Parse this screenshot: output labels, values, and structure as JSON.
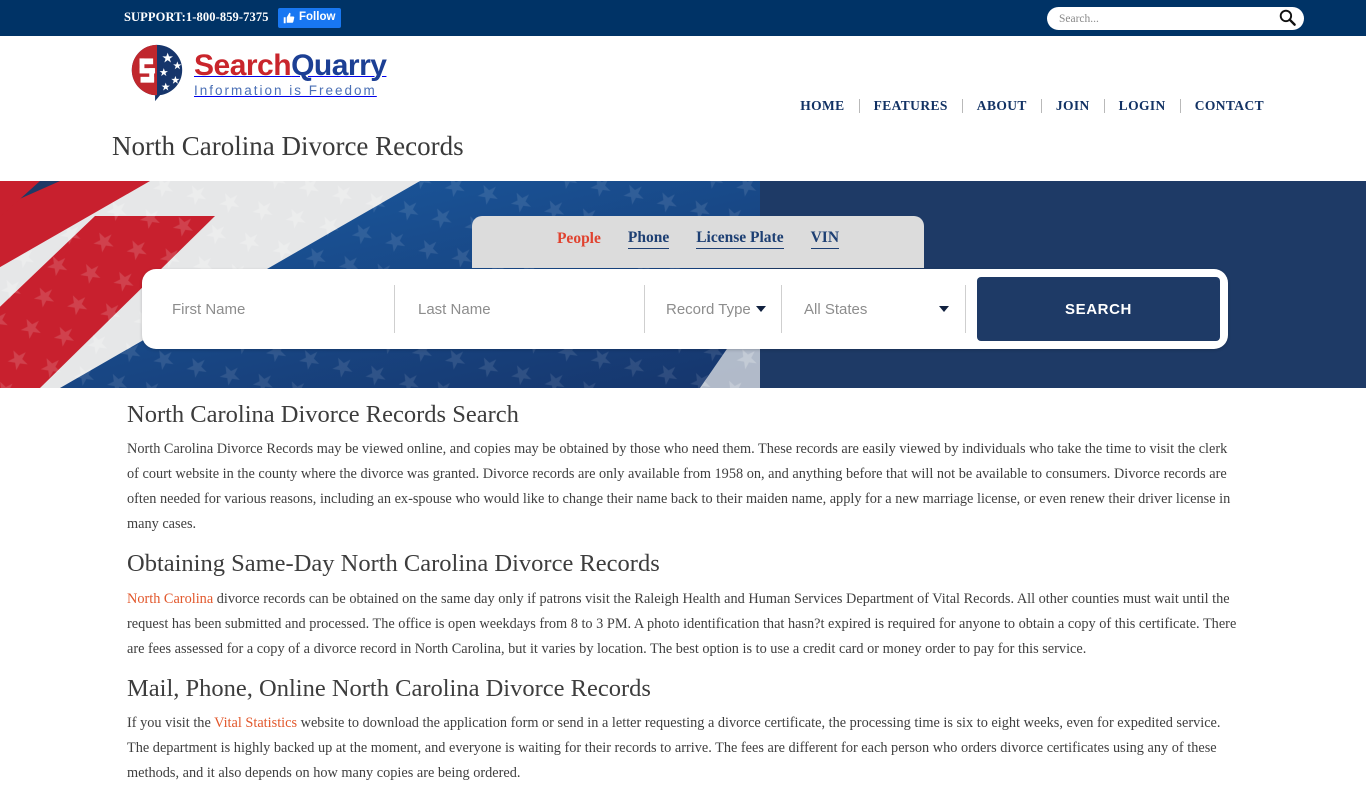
{
  "topbar": {
    "support": "SUPPORT:1-800-859-7375",
    "follow_label": "Follow",
    "follow_icon": "thumbs-up-icon",
    "search_placeholder": "Search...",
    "search_value": "",
    "search_icon": "magnifier-icon",
    "background_color": "#003366"
  },
  "header": {
    "logo_primary": "Search",
    "logo_secondary": "Quarry",
    "logo_tagline": "Information is Freedom",
    "logo_red": "#c9252c",
    "logo_blue": "#1c3f94",
    "nav": [
      {
        "label": "HOME"
      },
      {
        "label": "FEATURES"
      },
      {
        "label": "ABOUT"
      },
      {
        "label": "JOIN"
      },
      {
        "label": "LOGIN"
      },
      {
        "label": "CONTACT"
      }
    ]
  },
  "page": {
    "title": "North Carolina Divorce Records"
  },
  "hero": {
    "background_color": "#1e3a66",
    "tabs": [
      {
        "label": "People",
        "active": true
      },
      {
        "label": "Phone",
        "active": false
      },
      {
        "label": "License Plate",
        "active": false
      },
      {
        "label": "VIN",
        "active": false
      }
    ],
    "active_tab_color": "#e0422f",
    "tab_color": "#1d3f73",
    "form": {
      "first_name_placeholder": "First Name",
      "first_name_value": "",
      "last_name_placeholder": "Last Name",
      "last_name_value": "",
      "record_type_label": "Record Type",
      "state_label": "All States",
      "search_button": "SEARCH"
    }
  },
  "article": {
    "h2_main": "North Carolina Divorce Records Search",
    "p1": "North Carolina Divorce Records may be viewed online, and copies may be obtained by those who need them. These records are easily viewed by individuals who take the time to visit the clerk of court website in the county where the divorce was granted. Divorce records are only available from 1958 on, and anything before that will not be available to consumers. Divorce records are often needed for various reasons, including an ex-spouse who would like to change their name back to their maiden name, apply for a new marriage license, or even renew their driver license in many cases.",
    "h2_sameday": "Obtaining Same-Day North Carolina Divorce Records",
    "p2_link": "North Carolina",
    "p2_rest": " divorce records can be obtained on the same day only if patrons visit the Raleigh Health and Human Services Department of Vital Records. All other counties must wait until the request has been submitted and processed. The office is open weekdays from 8 to 3 PM. A photo identification that hasn?t expired is required for anyone to obtain a copy of this certificate. There are fees assessed for a copy of a divorce record in North Carolina, but it varies by location. The best option is to use a credit card or money order to pay for this service.",
    "h2_mail": "Mail, Phone, Online North Carolina Divorce Records",
    "p3_before": "If you visit the ",
    "p3_link": "Vital Statistics",
    "p3_after": " website to download the application form or send in a letter requesting a divorce certificate, the processing time is six to eight weeks, even for expedited service. The department is highly backed up at the moment, and everyone is waiting for their records to arrive. The fees are different for each person who orders divorce certificates using any of these methods, and it also depends on how many copies are being ordered.",
    "link_color": "#e2582c"
  }
}
